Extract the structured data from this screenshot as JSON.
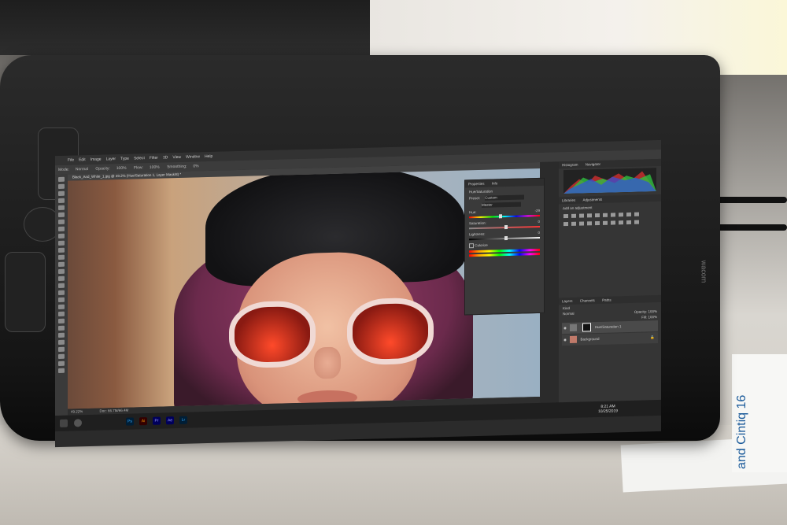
{
  "app": {
    "menus": [
      "File",
      "Edit",
      "Image",
      "Layer",
      "Type",
      "Select",
      "Filter",
      "3D",
      "View",
      "Window",
      "Help"
    ],
    "options": {
      "mode_label": "Mode:",
      "mode_value": "Normal",
      "opacity_label": "Opacity:",
      "opacity_value": "100%",
      "flow_label": "Flow:",
      "flow_value": "100%",
      "smoothing_label": "Smoothing:",
      "smoothing_value": "0%"
    },
    "doc_tab": "Black_And_White_1.jpg @ 49.2% (Hue/Saturation 1, Layer Mask/8) *",
    "status": {
      "zoom": "49.22%",
      "doc": "Doc: 66.7M/66.4M"
    }
  },
  "properties": {
    "tabs": [
      "Properties",
      "Info"
    ],
    "adjustment_title": "Hue/Saturation",
    "preset_label": "Preset:",
    "preset_value": "Custom",
    "channel_value": "Master",
    "hue_label": "Hue:",
    "hue_value": "-29",
    "hue_level": 0.42,
    "saturation_label": "Saturation:",
    "saturation_value": "0",
    "saturation_level": 0.5,
    "lightness_label": "Lightness:",
    "lightness_value": "0",
    "lightness_level": 0.5,
    "colorize_label": "Colorize"
  },
  "right_panel": {
    "top_tabs": [
      "Histogram",
      "Navigator"
    ],
    "mid_tabs": [
      "Libraries",
      "Adjustments"
    ],
    "add_adjustment": "Add an adjustment",
    "layer_tabs": [
      "Layers",
      "Channels",
      "Paths"
    ],
    "kind_label": "Kind",
    "blend_value": "Normal",
    "opacity_label": "Opacity:",
    "opacity_value": "100%",
    "fill_label": "Fill:",
    "fill_value": "100%",
    "layers": [
      {
        "name": "Hue/Saturation 1",
        "selected": true
      },
      {
        "name": "Background",
        "selected": false
      }
    ]
  },
  "taskbar": {
    "apps": [
      {
        "label": "Ps",
        "color": "#31a8ff",
        "bg": "#001e36"
      },
      {
        "label": "Ai",
        "color": "#ff9a00",
        "bg": "#330000"
      },
      {
        "label": "Pr",
        "color": "#9999ff",
        "bg": "#00005b"
      },
      {
        "label": "Ae",
        "color": "#9999ff",
        "bg": "#00005b"
      },
      {
        "label": "Lr",
        "color": "#31a8ff",
        "bg": "#001e36"
      }
    ],
    "time": "8:21 AM",
    "date": "10/25/2019"
  },
  "bezel": {
    "logo": "wacom"
  },
  "leaflet": {
    "text": "and Cintiq 16"
  }
}
